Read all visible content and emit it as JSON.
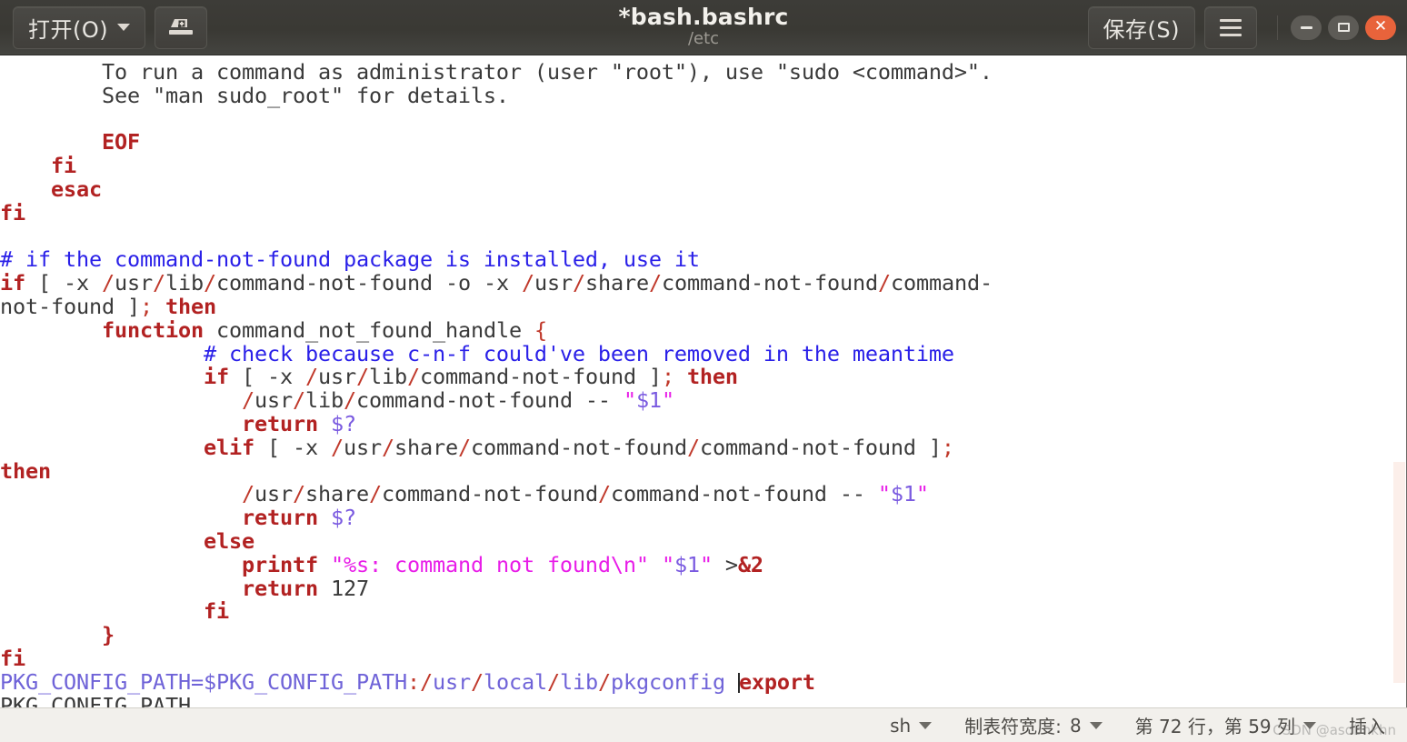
{
  "window": {
    "title": "*bash.bashrc",
    "subtitle": "/etc",
    "open_button": "打开(O)",
    "save_button": "保存(S)",
    "save_as_icon": "save-as-icon",
    "menu_icon": "hamburger-menu-icon",
    "minimize_icon": "minimize-icon",
    "maximize_icon": "maximize-icon",
    "close_icon": "close-icon",
    "close_glyph": "✕"
  },
  "editor": {
    "lines": [
      "        To run a command as administrator (user \"root\"), use \"sudo <command>\".",
      "        See \"man sudo_root\" for details.",
      "",
      "        EOF",
      "    fi",
      "    esac",
      "fi",
      "",
      "# if the command-not-found package is installed, use it",
      "if [ -x /usr/lib/command-not-found -o -x /usr/share/command-not-found/command-not-found ]; then",
      "        function command_not_found_handle {",
      "                # check because c-n-f could've been removed in the meantime",
      "                if [ -x /usr/lib/command-not-found ]; then",
      "                   /usr/lib/command-not-found -- \"$1\"",
      "                   return $?",
      "                elif [ -x /usr/share/command-not-found/command-not-found ]; then",
      "                   /usr/share/command-not-found/command-not-found -- \"$1\"",
      "                   return $?",
      "                else",
      "                   printf \"%s: command not found\\n\" \"$1\" >&2",
      "                   return 127",
      "                fi",
      "        }",
      "fi",
      "PKG_CONFIG_PATH=$PKG_CONFIG_PATH:/usr/local/lib/pkgconfig export",
      "PKG_CONFIG_PATH"
    ],
    "cursor_before_word": "export"
  },
  "statusbar": {
    "language": "sh",
    "tab_width_label": "制表符宽度:",
    "tab_width_value": "8",
    "position": "第 72 行，第 59 列",
    "insert_mode": "插入",
    "watermark": "CSDN @asdbnkhn"
  },
  "colors": {
    "titlebar_bg": "#3a3934",
    "editor_bg": "#ffffff",
    "statusbar_bg": "#f2f0ec",
    "keyword": "#b22222",
    "comment": "#2a20e8",
    "string": "#e81ee8",
    "variable": "#7a5ae0",
    "path": "#c0392b",
    "close_button": "#e8633b"
  }
}
